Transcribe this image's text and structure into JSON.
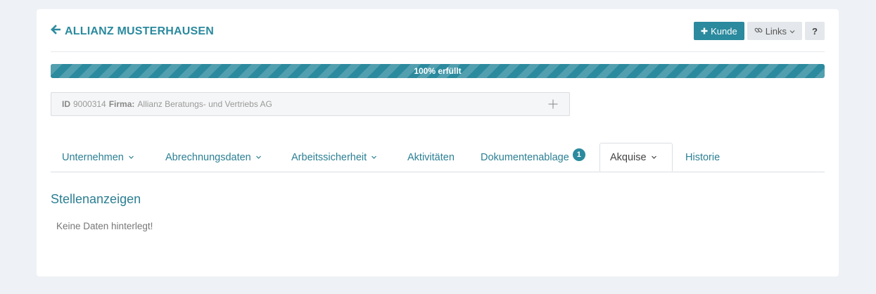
{
  "header": {
    "back_icon": "arrow-left-icon",
    "title": "ALLIANZ MUSTERHAUSEN",
    "buttons": {
      "kunde_label": "Kunde",
      "kunde_icon": "plus-icon",
      "links_label": "Links",
      "links_icon": "link-icon",
      "help_label": "?"
    }
  },
  "progress": {
    "label": "100% erfüllt",
    "percent": 100
  },
  "info": {
    "id_label": "ID",
    "id_value": "9000314",
    "firma_label": "Firma:",
    "firma_value": "Allianz Beratungs- und Vertriebs AG",
    "add_icon": "plus-icon"
  },
  "tabs": [
    {
      "label": "Unternehmen",
      "dropdown": true
    },
    {
      "label": "Abrechnungsdaten",
      "dropdown": true
    },
    {
      "label": "Arbeitssicherheit",
      "dropdown": true
    },
    {
      "label": "Aktivitäten",
      "dropdown": false
    },
    {
      "label": "Dokumentenablage",
      "dropdown": false,
      "badge": "1"
    },
    {
      "label": "Akquise",
      "dropdown": true,
      "active": true
    },
    {
      "label": "Historie",
      "dropdown": false
    }
  ],
  "content": {
    "section_title": "Stellenanzeigen",
    "empty_text": "Keine Daten hinterlegt!"
  },
  "colors": {
    "accent": "#2b8a9e",
    "page_background": "#eef1f5",
    "button_default": "#e4e7eb"
  }
}
